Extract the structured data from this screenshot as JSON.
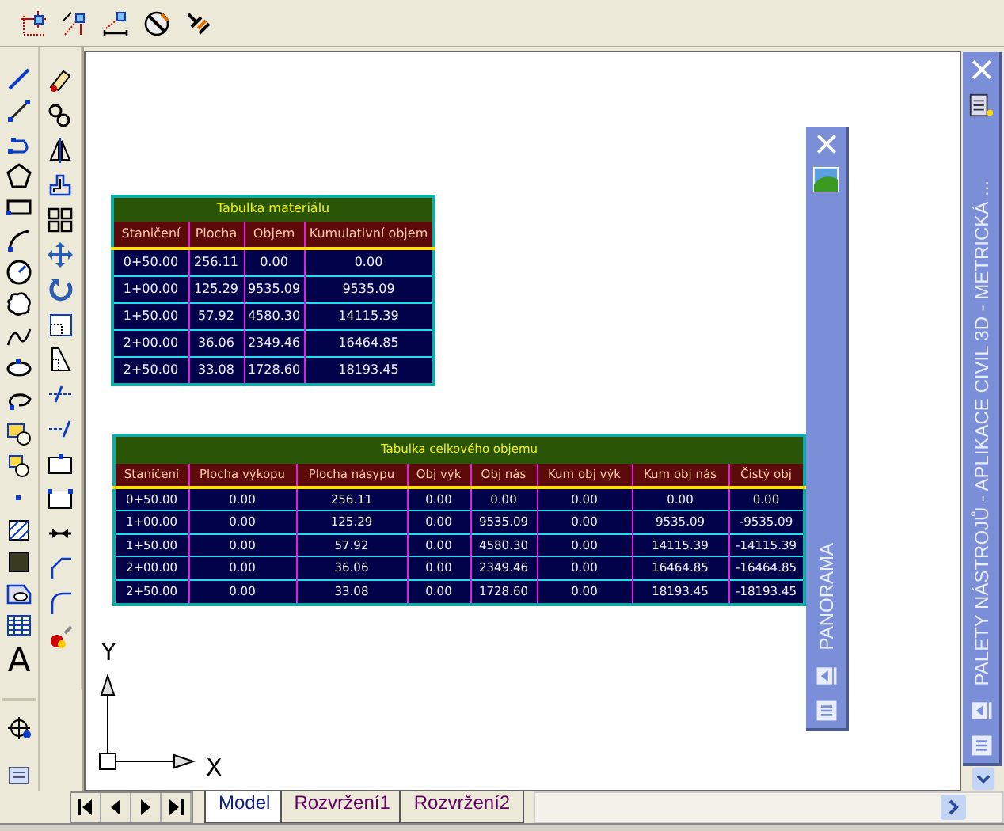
{
  "draw_toolbar": {
    "text_tool": "A"
  },
  "tables": [
    {
      "title": "Tabulka materiálu",
      "columns": [
        "Staničení",
        "Plocha",
        "Objem",
        "Kumulativní objem"
      ],
      "rows": [
        [
          "0+50.00",
          "256.11",
          "0.00",
          "0.00"
        ],
        [
          "1+00.00",
          "125.29",
          "9535.09",
          "9535.09"
        ],
        [
          "1+50.00",
          "57.92",
          "4580.30",
          "14115.39"
        ],
        [
          "2+00.00",
          "36.06",
          "2349.46",
          "16464.85"
        ],
        [
          "2+50.00",
          "33.08",
          "1728.60",
          "18193.45"
        ]
      ]
    },
    {
      "title": "Tabulka celkového objemu",
      "columns": [
        "Staničení",
        "Plocha výkopu",
        "Plocha násypu",
        "Obj výk",
        "Obj nás",
        "Kum obj výk",
        "Kum obj nás",
        "Čistý obj"
      ],
      "rows": [
        [
          "0+50.00",
          "0.00",
          "256.11",
          "0.00",
          "0.00",
          "0.00",
          "0.00",
          "0.00"
        ],
        [
          "1+00.00",
          "0.00",
          "125.29",
          "0.00",
          "9535.09",
          "0.00",
          "9535.09",
          "-9535.09"
        ],
        [
          "1+50.00",
          "0.00",
          "57.92",
          "0.00",
          "4580.30",
          "0.00",
          "14115.39",
          "-14115.39"
        ],
        [
          "2+00.00",
          "0.00",
          "36.06",
          "0.00",
          "2349.46",
          "0.00",
          "16464.85",
          "-16464.85"
        ],
        [
          "2+50.00",
          "0.00",
          "33.08",
          "0.00",
          "1728.60",
          "0.00",
          "18193.45",
          "-18193.45"
        ]
      ]
    }
  ],
  "ucs": {
    "y_label": "Y",
    "x_label": "X"
  },
  "palettes": [
    {
      "kind": "floating",
      "title": "PANORAMA"
    },
    {
      "kind": "docked",
      "title": "PALETY NÁSTROJŮ - APLIKACE CIVIL 3D - METRICKÁ ..."
    }
  ],
  "layout_tabs": [
    {
      "label": "Model",
      "selected": true
    },
    {
      "label": "Rozvržení1",
      "selected": false
    },
    {
      "label": "Rozvržení2",
      "selected": false
    }
  ]
}
